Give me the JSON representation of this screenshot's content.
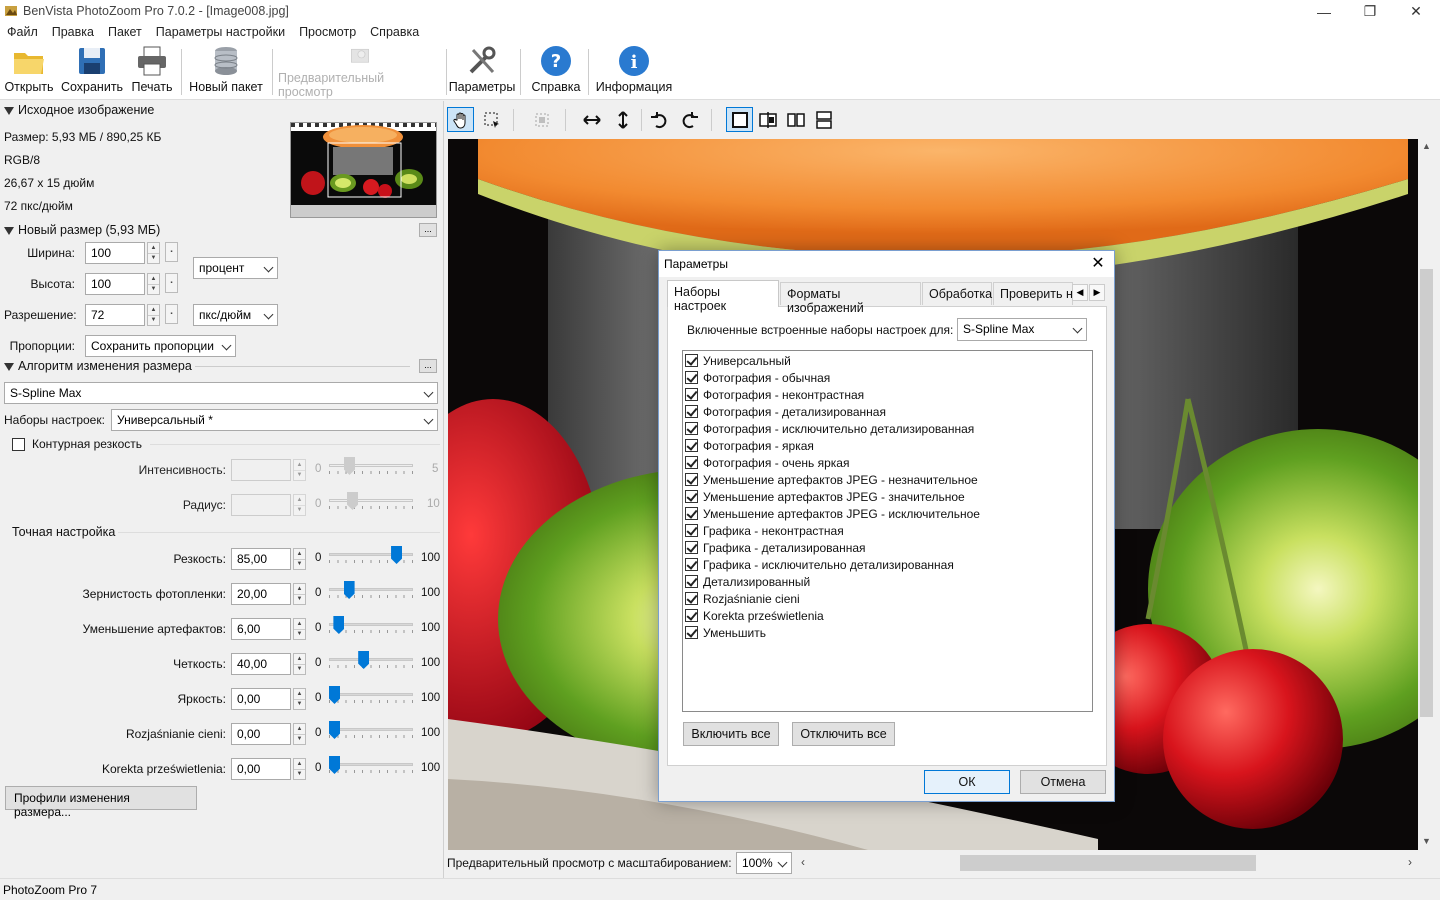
{
  "window": {
    "title": "BenVista PhotoZoom Pro 7.0.2 - [Image008.jpg]"
  },
  "menu": [
    "Файл",
    "Правка",
    "Пакет",
    "Параметры настройки",
    "Просмотр",
    "Справка"
  ],
  "toolbar": {
    "open": "Открыть",
    "save": "Сохранить",
    "print": "Печать",
    "batch": "Новый пакет",
    "preview": "Предварительный просмотр",
    "settings": "Параметры",
    "help": "Справка",
    "info": "Информация"
  },
  "source": {
    "header": "Исходное изображение",
    "size": "Размер: 5,93 МБ / 890,25 КБ",
    "mode": "RGB/8",
    "dims": "26,67 x 15 дюйм",
    "res": "72 пкс/дюйм"
  },
  "newsize": {
    "header": "Новый размер (5,93 МБ)",
    "width_label": "Ширина:",
    "width": "100",
    "height_label": "Высота:",
    "height": "100",
    "res_label": "Разрешение:",
    "res": "72",
    "unit": "процент",
    "res_unit": "пкс/дюйм",
    "prop_label": "Пропорции:",
    "prop": "Сохранить пропорции",
    "more": "..."
  },
  "algo": {
    "header": "Алгоритм изменения размера",
    "method": "S-Spline Max",
    "presets_label": "Наборы настроек:",
    "preset": "Универсальный *",
    "unsharp_label": "Контурная резкость",
    "intensity_label": "Интенсивность:",
    "intensity_min": "0",
    "intensity_max": "5",
    "radius_label": "Радиус:",
    "radius_min": "0",
    "radius_max": "10"
  },
  "fine": {
    "header": "Точная настройка",
    "rows": [
      {
        "label": "Резкость:",
        "value": "85,00",
        "min": "0",
        "max": "100",
        "level": 0.85
      },
      {
        "label": "Зернистость фотопленки:",
        "value": "20,00",
        "min": "0",
        "max": "100",
        "level": 0.2
      },
      {
        "label": "Уменьшение артефактов:",
        "value": "6,00",
        "min": "0",
        "max": "100",
        "level": 0.06
      },
      {
        "label": "Четкость:",
        "value": "40,00",
        "min": "0",
        "max": "100",
        "level": 0.4
      },
      {
        "label": "Яркость:",
        "value": "0,00",
        "min": "0",
        "max": "100",
        "level": 0
      },
      {
        "label": "Rozjaśnianie cieni:",
        "value": "0,00",
        "min": "0",
        "max": "100",
        "level": 0
      },
      {
        "label": "Korekta prześwietlenia:",
        "value": "0,00",
        "min": "0",
        "max": "100",
        "level": 0
      }
    ],
    "profiles_button": "Профили изменения размера..."
  },
  "preview": {
    "label": "Предварительный просмотр с масштабированием:",
    "zoom": "100%"
  },
  "dialog": {
    "title": "Параметры",
    "tabs": [
      "Наборы настроек",
      "Форматы изображений",
      "Обработка",
      "Проверить на"
    ],
    "presets_for_label": "Включенные встроенные наборы настроек для:",
    "presets_for_value": "S-Spline Max",
    "items": [
      "Универсальный",
      "Фотография - обычная",
      "Фотография - неконтрастная",
      "Фотография - детализированная",
      "Фотография - исключительно детализированная",
      "Фотография - яркая",
      "Фотография - очень яркая",
      "Уменьшение артефактов JPEG - незначительное",
      "Уменьшение артефактов JPEG - значительное",
      "Уменьшение артефактов JPEG - исключительное",
      "Графика - неконтрастная",
      "Графика - детализированная",
      "Графика - исключительно детализированная",
      "Детализированный",
      "Rozjaśnianie cieni",
      "Korekta prześwietlenia",
      "Уменьшить"
    ],
    "enable_all": "Включить все",
    "disable_all": "Отключить все",
    "ok": "ОК",
    "cancel": "Отмена"
  },
  "status": {
    "text": "PhotoZoom Pro 7"
  }
}
